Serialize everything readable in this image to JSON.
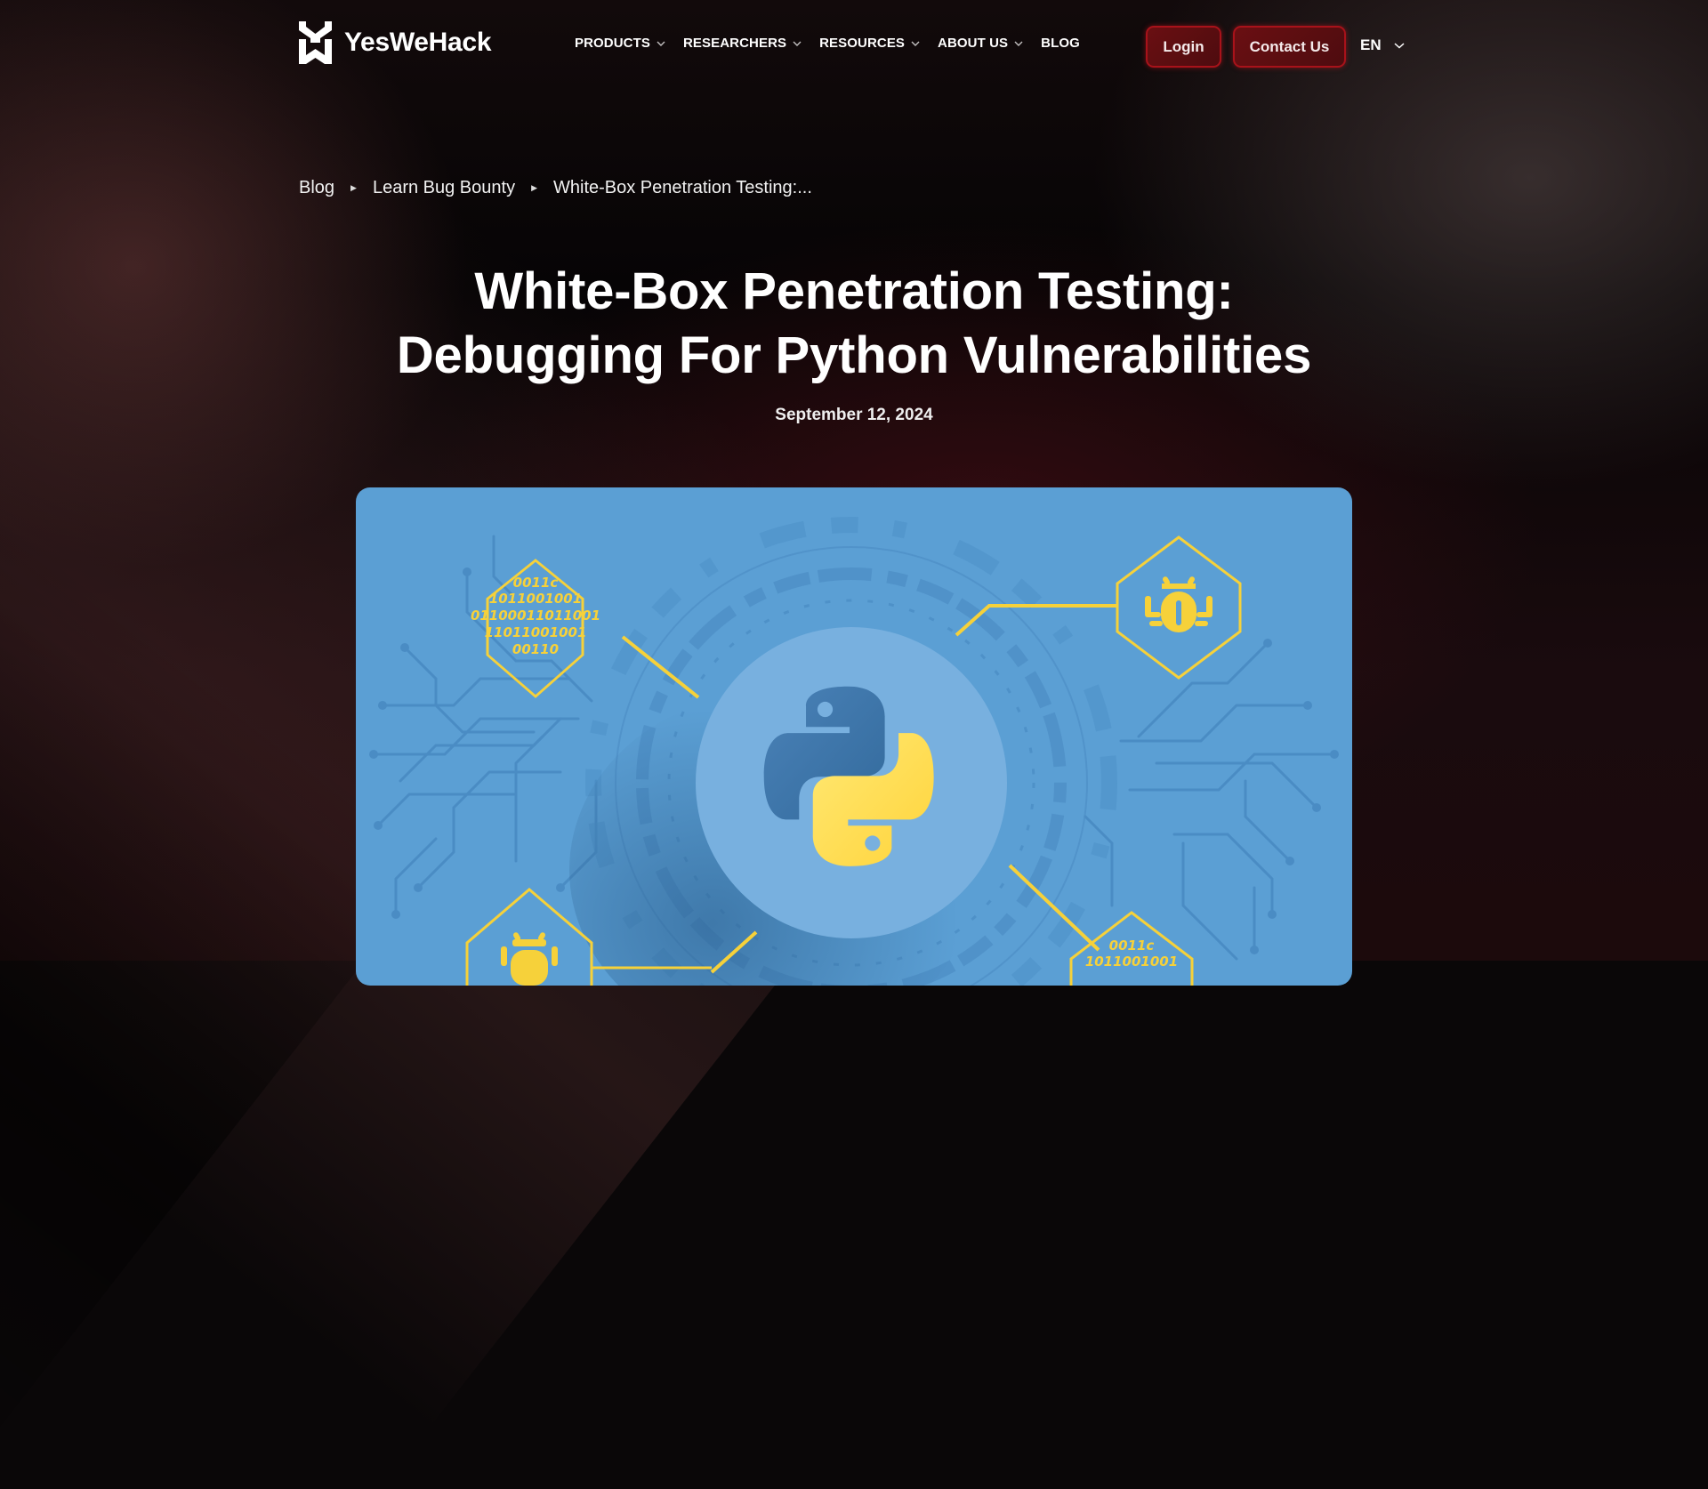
{
  "brand": {
    "name": "YesWeHack",
    "logo_icon": "ywh-logo-icon"
  },
  "nav": {
    "items": [
      {
        "label": "PRODUCTS",
        "has_dropdown": true
      },
      {
        "label": "RESEARCHERS",
        "has_dropdown": true
      },
      {
        "label": "RESOURCES",
        "has_dropdown": true
      },
      {
        "label": "ABOUT US",
        "has_dropdown": true
      },
      {
        "label": "BLOG",
        "has_dropdown": false
      }
    ],
    "login_label": "Login",
    "contact_label": "Contact Us",
    "language": "EN"
  },
  "breadcrumb": {
    "items": [
      "Blog",
      "Learn Bug Bounty",
      "White-Box Penetration Testing:..."
    ],
    "separator_icon": "triangle-right-icon"
  },
  "article": {
    "title_line1": "White-Box Penetration Testing:",
    "title_line2": "Debugging For Python Vulnerabilities",
    "date": "September 12, 2024"
  },
  "hero": {
    "description": "Python logo in a circle surrounded by circuit traces, binary-code hexagons and bug icons",
    "binary_rows": [
      "0011c",
      "1011001001",
      "01100011011001",
      "11011001001",
      "00110"
    ],
    "colors": {
      "background": "#5b9fd4",
      "accent": "#f6d13a",
      "python_blue": "#3d73a8",
      "python_yellow": "#ffd842"
    }
  },
  "colors": {
    "button_fill": "#5a0e10",
    "button_border": "#a8121a"
  }
}
